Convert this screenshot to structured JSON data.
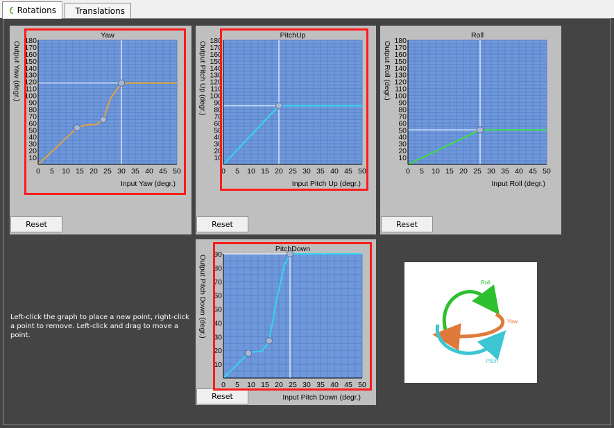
{
  "tabs": [
    {
      "label": "Rotations",
      "active": true,
      "icon": "rotation-icon"
    },
    {
      "label": "Translations",
      "active": false,
      "icon": "axes-icon"
    }
  ],
  "reset_label": "Reset",
  "instructions": "Left-click the graph to place a new point, right-click a point to remove. Left-click and drag to move a point.",
  "legend_image": {
    "labels": [
      "Roll",
      "Yaw",
      "Pitch"
    ],
    "colors": {
      "roll": "#2ec02e",
      "yaw": "#e07a3c",
      "pitch": "#3cc6d4"
    }
  },
  "colors": {
    "plot_bg": "#6e97dc",
    "grid": "#5a83c8",
    "crosshair": "#dce6f5",
    "highlight": "#ff1a1a",
    "panel_bg": "#bfbfbf"
  },
  "chart_data": [
    {
      "id": "yaw",
      "type": "line",
      "title": "Yaw",
      "xlabel": "Input Yaw (degr.)",
      "ylabel": "Output Yaw (degr.)",
      "xlim": [
        0,
        50
      ],
      "ylim": [
        0,
        180
      ],
      "xticks": [
        "0",
        "5",
        "10",
        "15",
        "20",
        "25",
        "30",
        "35",
        "40",
        "45",
        "50"
      ],
      "yticks": [
        "10",
        "20",
        "30",
        "40",
        "50",
        "60",
        "70",
        "80",
        "90",
        "100",
        "110",
        "120",
        "130",
        "140",
        "150",
        "160",
        "170",
        "180"
      ],
      "color": "#e3a33a",
      "points": [
        [
          14,
          53
        ],
        [
          23.5,
          65
        ],
        [
          30,
          118
        ]
      ],
      "x": [
        0,
        14,
        17,
        21,
        23.5,
        26,
        30,
        50
      ],
      "y": [
        0,
        53,
        57,
        58,
        65,
        95,
        118,
        118
      ],
      "highlighted": true
    },
    {
      "id": "pitchup",
      "type": "line",
      "title": "PitchUp",
      "xlabel": "Input Pitch Up (degr.)",
      "ylabel": "Output Pitch Up (degr.)",
      "xlim": [
        0,
        50
      ],
      "ylim": [
        0,
        180
      ],
      "xticks": [
        "0",
        "5",
        "10",
        "15",
        "20",
        "25",
        "30",
        "35",
        "40",
        "45",
        "50"
      ],
      "yticks": [
        "10",
        "20",
        "30",
        "40",
        "50",
        "60",
        "70",
        "80",
        "90",
        "100",
        "110",
        "120",
        "130",
        "140",
        "150",
        "160",
        "170",
        "180"
      ],
      "color": "#33d6f0",
      "points": [
        [
          20,
          85
        ]
      ],
      "x": [
        0,
        20,
        50
      ],
      "y": [
        0,
        85,
        85
      ],
      "highlighted": true
    },
    {
      "id": "roll",
      "type": "line",
      "title": "Roll",
      "xlabel": "Input Roll (degr.)",
      "ylabel": "Output Roll (degr.)",
      "xlim": [
        0,
        50
      ],
      "ylim": [
        0,
        180
      ],
      "xticks": [
        "0",
        "5",
        "10",
        "15",
        "20",
        "25",
        "30",
        "35",
        "40",
        "45",
        "50"
      ],
      "yticks": [
        "10",
        "20",
        "30",
        "40",
        "50",
        "60",
        "70",
        "80",
        "90",
        "100",
        "110",
        "120",
        "130",
        "140",
        "150",
        "160",
        "170",
        "180"
      ],
      "color": "#3ce03c",
      "points": [
        [
          26,
          50
        ]
      ],
      "x": [
        0,
        26,
        50
      ],
      "y": [
        0,
        50,
        50
      ],
      "highlighted": false
    },
    {
      "id": "pitchdown",
      "type": "line",
      "title": "PitchDown",
      "xlabel": "Input Pitch Down (degr.)",
      "ylabel": "Output Pitch Down (degr.)",
      "xlim": [
        0,
        50
      ],
      "ylim": [
        0,
        90
      ],
      "xticks": [
        "0",
        "5",
        "10",
        "15",
        "20",
        "25",
        "30",
        "35",
        "40",
        "45",
        "50"
      ],
      "yticks": [
        "10",
        "20",
        "30",
        "40",
        "50",
        "60",
        "70",
        "80",
        "90"
      ],
      "color": "#33d6f0",
      "points": [
        [
          9,
          18
        ],
        [
          16.5,
          27
        ],
        [
          24,
          90
        ]
      ],
      "x": [
        0,
        9,
        11,
        14,
        16.5,
        19,
        22,
        24,
        50
      ],
      "y": [
        0,
        18,
        19,
        19.5,
        27,
        55,
        82,
        90,
        90
      ],
      "highlighted": true
    }
  ]
}
